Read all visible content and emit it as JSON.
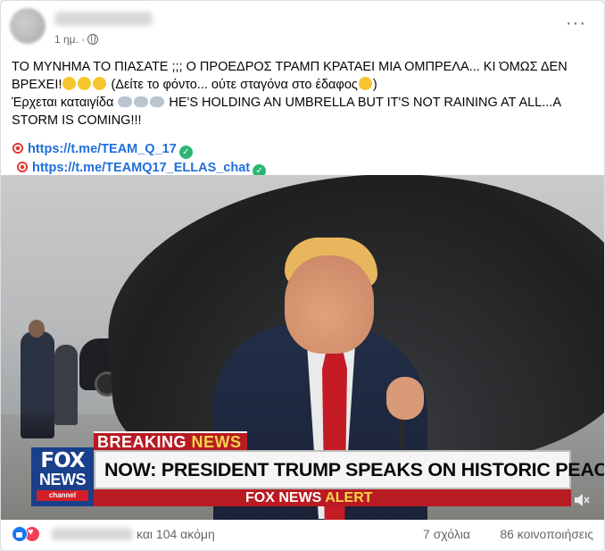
{
  "post": {
    "time": "1 ημ. ·",
    "privacy_icon": "globe-icon",
    "more_icon": "···",
    "text_lines": [
      "ΤΟ ΜΥΝΗΜΑ ΤΟ ΠΙΑΣΑΤΕ ;;; Ο ΠΡΟΕΔΡΟΣ ΤΡΑΜΠ ΚΡΑΤΑΕΙ ΜΙΑ ΟΜΠΡΕΛΑ... ΚΙ ΌΜΩΣ ΔΕΝ",
      "ΒΡΕΧΕΙ!",
      " (Δείτε το φόντο... ούτε σταγόνα στο έδαφος",
      "Έρχεται καταιγίδα ",
      " HE'S HOLDING AN UMBRELLA BUT IT'S NOT RAINING AT ALL...A",
      "STORM IS COMING!!!"
    ],
    "close_paren": ")",
    "links": [
      "https://t.me/TEAM_Q_17",
      "https://t.me/TEAMQ17_ELLAS_chat"
    ]
  },
  "video": {
    "breaking_label": "BREAKING",
    "breaking_news": "NEWS",
    "headline": "NOW: PRESIDENT TRUMP SPEAKS ON HISTORIC PEACE DEAL",
    "alert_brand": "FOX NEWS",
    "alert_word": "ALERT",
    "logo_fox": "FOX",
    "logo_news": "NEWS",
    "logo_channel": "channel"
  },
  "footer": {
    "reactions_suffix": "και 104 ακόμη",
    "comments": "7 σχόλια",
    "shares": "86 κοινοποιήσεις"
  },
  "colors": {
    "link": "#216fdb",
    "fox_blue": "#1a3f8b",
    "fox_red": "#b81b22",
    "like_blue": "#1877f2",
    "love_red": "#f33e58"
  }
}
